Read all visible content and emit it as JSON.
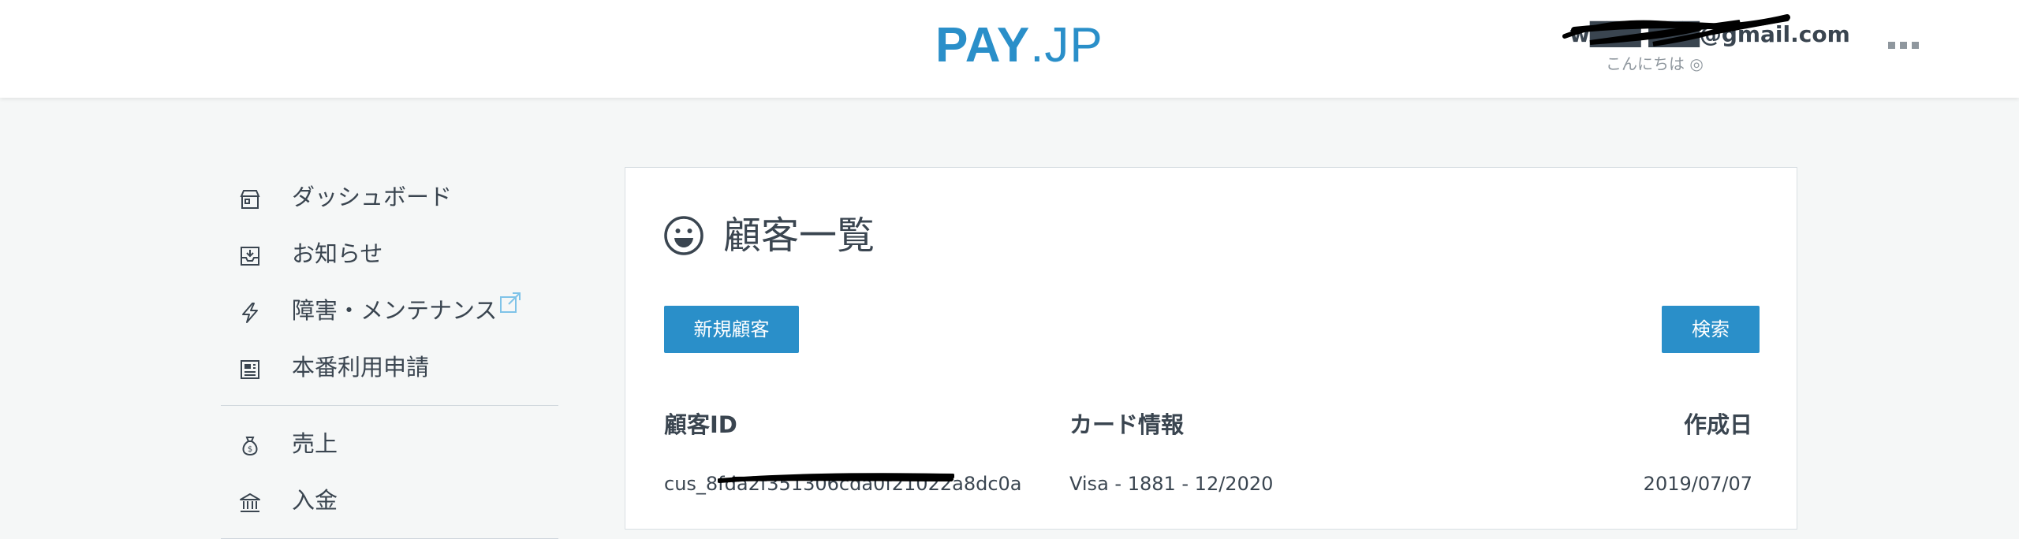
{
  "header": {
    "logo_bold": "PAY",
    "logo_light": ".JP",
    "user_email": "w███ ███@gmail.com",
    "greeting": "こんにちは ◎",
    "more_label": "..."
  },
  "sidebar": {
    "items": [
      {
        "label": "ダッシュボード",
        "icon": "store-icon"
      },
      {
        "label": "お知らせ",
        "icon": "inbox-icon"
      },
      {
        "label": "障害・メンテナンス",
        "icon": "lightning-icon",
        "external": true
      },
      {
        "label": "本番利用申請",
        "icon": "newspaper-icon"
      },
      {
        "label": "売上",
        "icon": "money-bag-icon"
      },
      {
        "label": "入金",
        "icon": "bank-icon"
      }
    ]
  },
  "main": {
    "title": "顧客一覧",
    "new_button": "新規顧客",
    "search_button": "検索",
    "columns": [
      "顧客ID",
      "カード情報",
      "作成日"
    ],
    "rows": [
      {
        "id": "cus_8fda2f351306cda0f21022a8dc0a",
        "card": "Visa - 1881 - 12/2020",
        "created": "2019/07/07"
      }
    ]
  },
  "colors": {
    "accent": "#2a8fc9",
    "text": "#3a4550",
    "muted": "#8f979e",
    "background": "#f5f7f7"
  }
}
